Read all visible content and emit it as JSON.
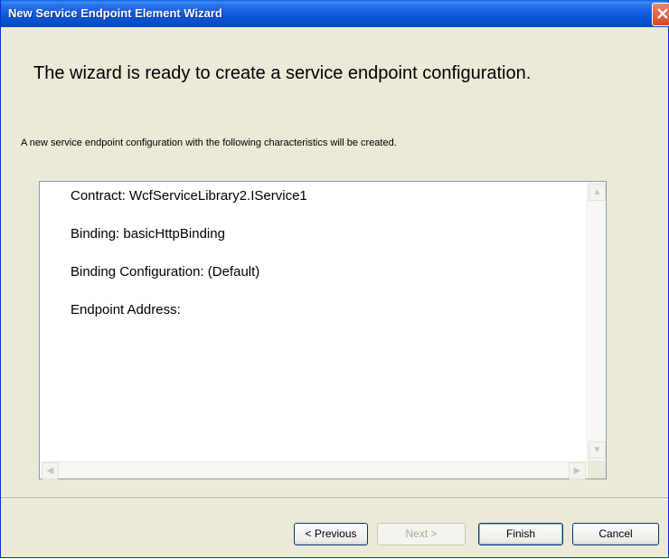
{
  "window": {
    "title": "New Service Endpoint Element Wizard"
  },
  "page": {
    "heading": "The wizard is ready to create a service endpoint configuration.",
    "description": "A new service endpoint configuration with the following characteristics will be created."
  },
  "summary": {
    "items": [
      "Contract: WcfServiceLibrary2.IService1",
      "Binding: basicHttpBinding",
      "Binding Configuration: (Default)",
      "Endpoint Address:"
    ]
  },
  "buttons": {
    "previous": "< Previous",
    "next": "Next >",
    "finish": "Finish",
    "cancel": "Cancel"
  },
  "colors": {
    "titlebar": "#0a57d6",
    "dialog_bg": "#ece9d8",
    "close": "#d14a22"
  },
  "icons": {
    "close": "close-icon",
    "scroll_up": "scroll-up-arrow",
    "scroll_down": "scroll-down-arrow",
    "scroll_left": "scroll-left-arrow",
    "scroll_right": "scroll-right-arrow"
  },
  "state": {
    "next_enabled": false,
    "default_button": "finish"
  }
}
